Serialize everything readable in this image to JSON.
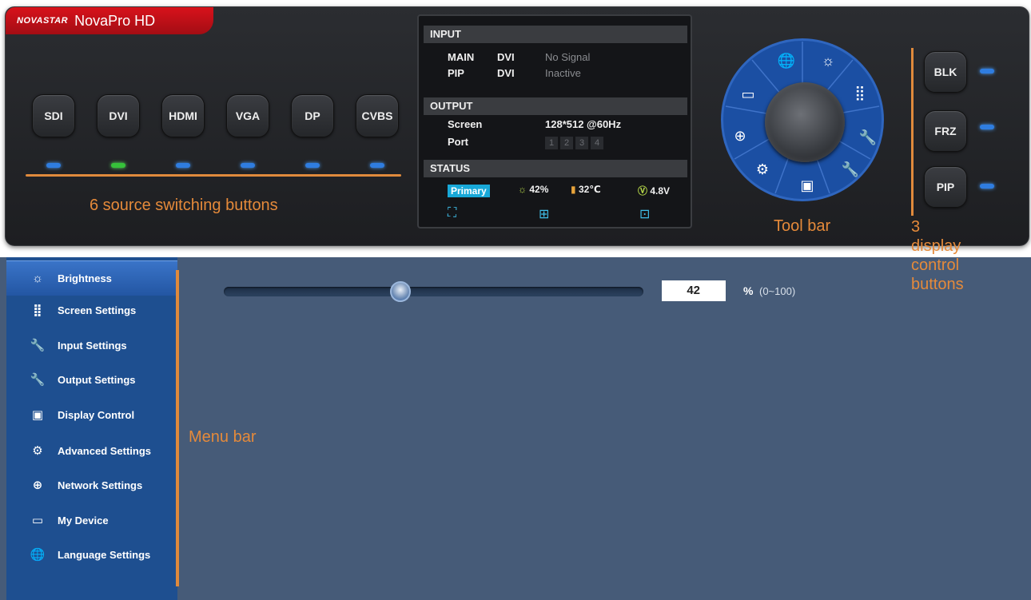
{
  "device": {
    "brand_logo": "NOVASTAR",
    "model": "NovaPro HD",
    "sources": [
      "SDI",
      "DVI",
      "HDMI",
      "VGA",
      "DP",
      "CVBS"
    ],
    "source_led_active": "DVI",
    "source_annotation": "6 source switching buttons"
  },
  "status_screen": {
    "input_header": "INPUT",
    "input_rows": [
      {
        "label": "MAIN",
        "type": "DVI",
        "state": "No Signal"
      },
      {
        "label": "PIP",
        "type": "DVI",
        "state": "Inactive"
      }
    ],
    "output_header": "OUTPUT",
    "screen_label": "Screen",
    "screen_value": "128*512 @60Hz",
    "port_label": "Port",
    "ports": [
      "1",
      "2",
      "3",
      "4"
    ],
    "status_header": "STATUS",
    "primary": "Primary",
    "brightness": "42%",
    "temperature": "32℃",
    "voltage": "4.8V"
  },
  "toolbar": {
    "annotation": "Tool bar",
    "icons": [
      "language-icon",
      "brightness-icon",
      "screen-settings-icon",
      "input-settings-icon",
      "output-settings-icon",
      "display-control-icon",
      "advanced-settings-icon",
      "network-icon",
      "my-device-icon"
    ]
  },
  "display_controls": {
    "buttons": [
      "BLK",
      "FRZ",
      "PIP"
    ],
    "annotation_number": "3",
    "annotation_lines": [
      "display",
      "control",
      "buttons"
    ]
  },
  "menu": {
    "annotation": "Menu bar",
    "items": [
      {
        "label": "Brightness",
        "icon": "brightness-icon",
        "active": true
      },
      {
        "label": "Screen Settings",
        "icon": "grid-icon"
      },
      {
        "label": "Input Settings",
        "icon": "wrench-in-icon"
      },
      {
        "label": "Output Settings",
        "icon": "wrench-out-icon"
      },
      {
        "label": "Display Control",
        "icon": "image-icon"
      },
      {
        "label": "Advanced Settings",
        "icon": "gear-icon"
      },
      {
        "label": "Network Settings",
        "icon": "globe-icon"
      },
      {
        "label": "My Device",
        "icon": "device-icon"
      },
      {
        "label": "Language Settings",
        "icon": "language-icon"
      }
    ]
  },
  "brightness_panel": {
    "value": "42",
    "value_fraction": 0.42,
    "unit": "%",
    "range": "(0~100)"
  },
  "colors": {
    "accent_orange": "#e08a3c",
    "menu_blue": "#1e4f90",
    "content_bg": "#465b78",
    "led_blue": "#2f7de0",
    "led_green": "#36c23a",
    "brand_red": "#d8121b"
  }
}
